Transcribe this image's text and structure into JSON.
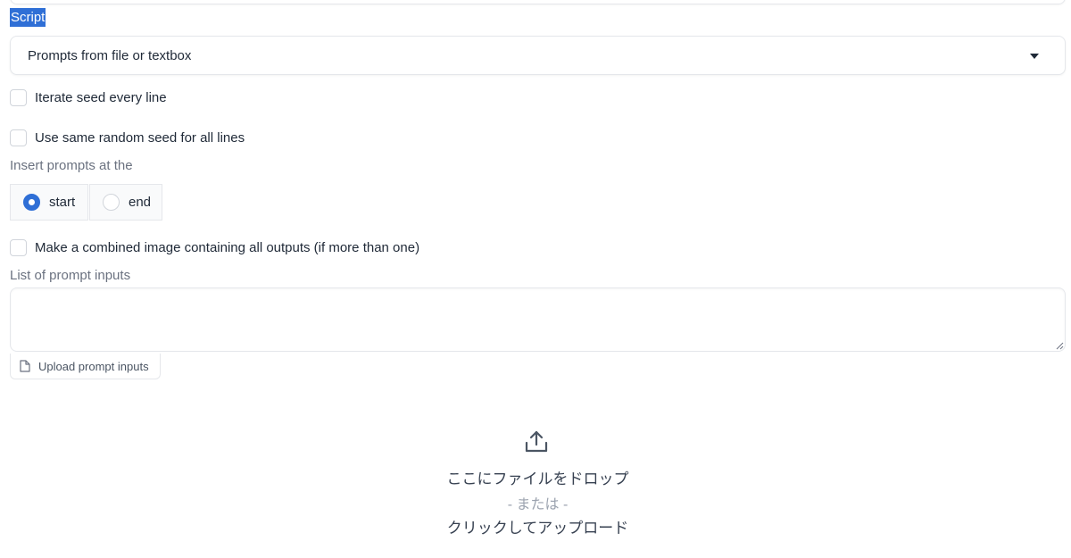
{
  "script": {
    "label": "Script",
    "selected": "Prompts from file or textbox"
  },
  "options": {
    "iterate_seed": "Iterate seed every line",
    "same_seed": "Use same random seed for all lines",
    "combined_image": "Make a combined image containing all outputs (if more than one)"
  },
  "insert": {
    "label": "Insert prompts at the",
    "choices": [
      "start",
      "end"
    ],
    "selected": "start"
  },
  "prompt_list": {
    "label": "List of prompt inputs",
    "value": ""
  },
  "upload": {
    "tab_label": "Upload prompt inputs",
    "drop_text": "ここにファイルをドロップ",
    "or_text": "- または -",
    "click_text": "クリックしてアップロード"
  },
  "colors": {
    "accent": "#2f6fd6",
    "border": "#e5e7eb",
    "muted_text": "#6b7280"
  },
  "icons": {
    "dropdown": "chevron-down-icon",
    "file": "file-icon",
    "upload": "upload-icon"
  }
}
